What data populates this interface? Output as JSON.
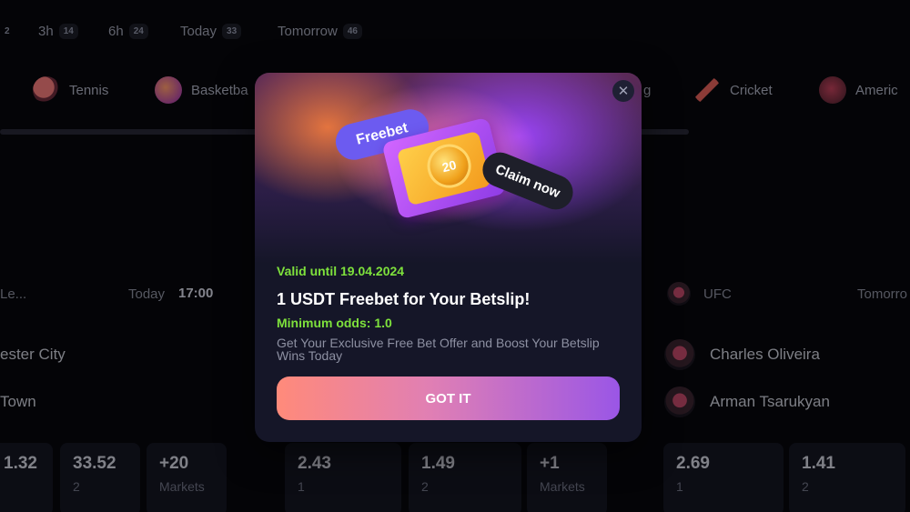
{
  "time_filters": [
    {
      "label": "",
      "count": "2"
    },
    {
      "label": "3h",
      "count": "14"
    },
    {
      "label": "6h",
      "count": "24"
    },
    {
      "label": "Today",
      "count": "33"
    },
    {
      "label": "Tomorrow",
      "count": "46"
    }
  ],
  "sports": [
    {
      "label": "Tennis",
      "icon": "tennis-racket-icon"
    },
    {
      "label": "Basketba",
      "icon": "basketball-icon"
    },
    {
      "label": "g",
      "icon": ""
    },
    {
      "label": "Cricket",
      "icon": "cricket-bat-icon"
    },
    {
      "label": "Americ",
      "icon": "american-football-helmet-icon"
    }
  ],
  "left_match": {
    "league": "Le...",
    "day": "Today",
    "time": "17:00",
    "team1": "ester City",
    "team2": "Town",
    "odds": [
      {
        "value": "1.32",
        "label": ""
      },
      {
        "value": "33.52",
        "label": "2"
      },
      {
        "value": "+20",
        "label": "Markets"
      }
    ]
  },
  "middle_match": {
    "odds": [
      {
        "value": "2.43",
        "label": "1"
      },
      {
        "value": "1.49",
        "label": "2"
      },
      {
        "value": "+1",
        "label": "Markets"
      }
    ]
  },
  "right_match": {
    "league": "UFC",
    "day": "Tomorro",
    "team1": "Charles Oliveira",
    "team2": "Arman Tsarukyan",
    "odds": [
      {
        "value": "2.69",
        "label": "1"
      },
      {
        "value": "1.41",
        "label": "2"
      }
    ]
  },
  "modal": {
    "close_symbol": "✕",
    "hero": {
      "freebet_label": "Freebet",
      "coin_value": "20",
      "claim_label": "Claim now"
    },
    "valid_until": "Valid until 19.04.2024",
    "headline": "1 USDT Freebet for Your Betslip!",
    "min_odds": "Minimum odds: 1.0",
    "description": "Get Your Exclusive Free Bet Offer and Boost Your Betslip Wins Today",
    "button_label": "GOT IT"
  },
  "colors": {
    "accent_green": "#7ee13c",
    "button_gradient_start": "#ff8a7a",
    "button_gradient_end": "#9a56e6",
    "modal_bg": "#151628"
  }
}
